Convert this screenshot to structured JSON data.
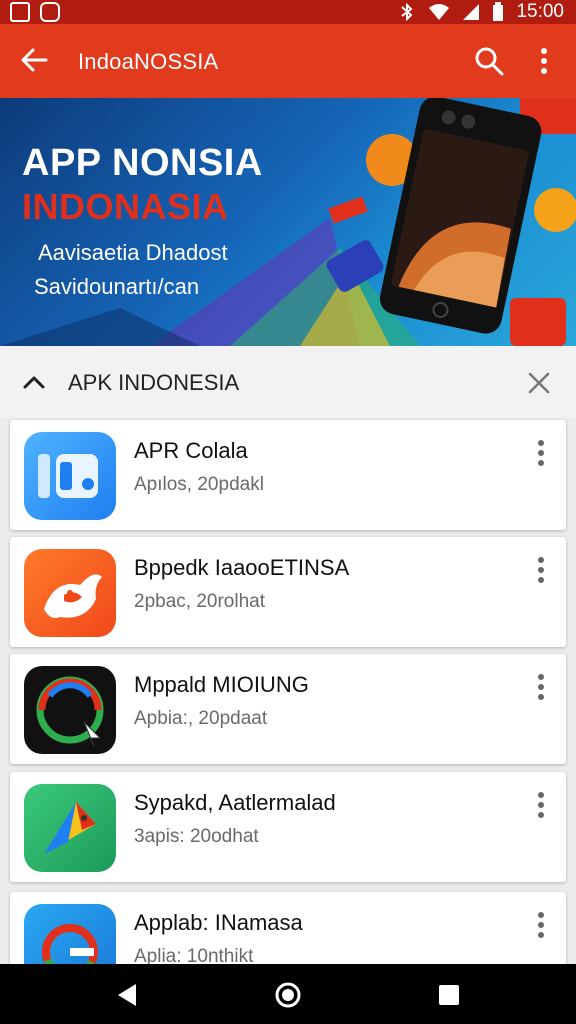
{
  "status_bar": {
    "time": "15:00"
  },
  "toolbar": {
    "title": "IndoaNOSSIA"
  },
  "banner": {
    "headline": "APP NONSIA",
    "headline2": "INDONASIA",
    "subtitle1": "Aavisaetia Dhadost",
    "subtitle2": "Savidounartı/can"
  },
  "section": {
    "title": "APK INDONESIA"
  },
  "apps": [
    {
      "name": "APR Colala",
      "sub": "Apılos, 20pdakl",
      "icon": "blocks-app-icon"
    },
    {
      "name": "Bppedk IaaooETINSA",
      "sub": "2pbac, 20rolhat",
      "icon": "phoenix-app-icon"
    },
    {
      "name": "Mppald MIOIUNG",
      "sub": "Apbia:, 20pdaat",
      "icon": "dial-app-icon"
    },
    {
      "name": "Sypakd, Aatlermalad",
      "sub": "3apis: 20odhat",
      "icon": "paper-plane-app-icon"
    },
    {
      "name": "Applab: INamasa",
      "sub": "Aplia: 10nthikt",
      "icon": "g-app-icon"
    }
  ],
  "colors": {
    "toolbar": "#e23a1c",
    "status_bar": "#b01c0f",
    "banner_accent": "#e0301c"
  }
}
